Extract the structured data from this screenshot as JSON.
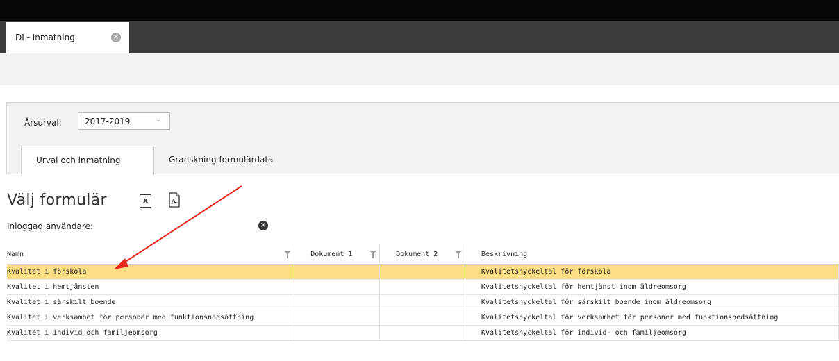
{
  "app_tab": {
    "title": "DI - Inmatning",
    "close_icon": "close-circle-icon"
  },
  "filter_panel": {
    "year_label": "Årsurval:",
    "year_value": "2017-2019"
  },
  "tabs": [
    {
      "label": "Urval och inmatning",
      "active": true
    },
    {
      "label": "Granskning formulärdata",
      "active": false
    }
  ],
  "page_title": "Välj formulär",
  "export_icons": [
    "excel-export-icon",
    "pdf-export-icon"
  ],
  "user": {
    "label": "Inloggad användare:",
    "value": ""
  },
  "table": {
    "columns": [
      "Namn",
      "Dokument 1",
      "Dokument 2",
      "Beskrivning"
    ],
    "rows": [
      {
        "namn": "Kvalitet i förskola",
        "dok1": "",
        "dok2": "",
        "beskrivning": "Kvalitetsnyckeltal för förskola",
        "selected": true
      },
      {
        "namn": "Kvalitet i hemtjänsten",
        "dok1": "",
        "dok2": "",
        "beskrivning": "Kvalitetsnyckeltal för hemtjänst inom äldreomsorg",
        "selected": false
      },
      {
        "namn": "Kvalitet i särskilt boende",
        "dok1": "",
        "dok2": "",
        "beskrivning": "Kvalitetsnyckeltal för särskilt boende inom äldreomsorg",
        "selected": false
      },
      {
        "namn": "Kvalitet i verksamhet för personer med funktionsnedsättning",
        "dok1": "",
        "dok2": "",
        "beskrivning": "Kvalitetsnyckeltal för verksamhet för personer med funktionsnedsättning",
        "selected": false
      },
      {
        "namn": "Kvalitet i individ och familjeomsorg",
        "dok1": "",
        "dok2": "",
        "beskrivning": "Kvalitetsnyckeltal för individ- och familjeomsorg",
        "selected": false
      }
    ]
  },
  "colors": {
    "selected_row": "#fcdf85",
    "annotation_arrow": "#e8261e",
    "tabbar": "#3b3b3b"
  }
}
